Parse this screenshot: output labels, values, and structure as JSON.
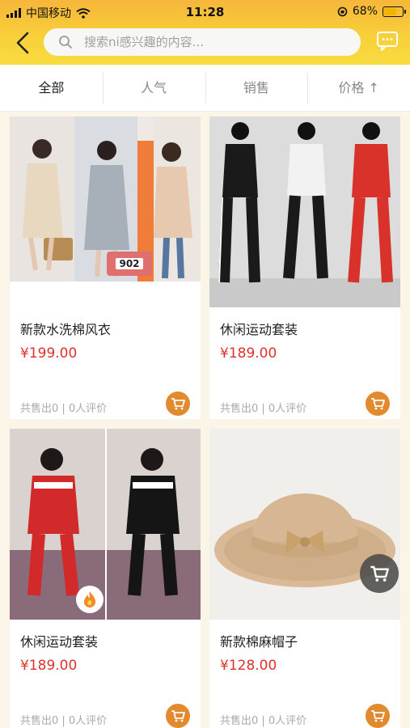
{
  "status_bar": {
    "carrier": "中国移动",
    "time": "11:28",
    "battery": "68%"
  },
  "header": {
    "search_placeholder": "搜索ni感兴趣的内容..."
  },
  "tabs": [
    {
      "label": "全部"
    },
    {
      "label": "人气"
    },
    {
      "label": "销售"
    },
    {
      "label": "价格 ↑"
    }
  ],
  "products": [
    {
      "title": "新款水洗棉风衣",
      "price": "¥199.00",
      "stats": "共售出0 | 0人评价",
      "badge": "902"
    },
    {
      "title": "休闲运动套装",
      "price": "¥189.00",
      "stats": "共售出0 | 0人评价"
    },
    {
      "title": "休闲运动套装",
      "price": "¥189.00",
      "stats": "共售出0 | 0人评价"
    },
    {
      "title": "新款棉麻帽子",
      "price": "¥128.00",
      "stats": "共售出0 | 0人评价"
    }
  ],
  "colors": {
    "accent": "#f8c93a",
    "price": "#e0312a",
    "cart": "#e28a2f"
  }
}
